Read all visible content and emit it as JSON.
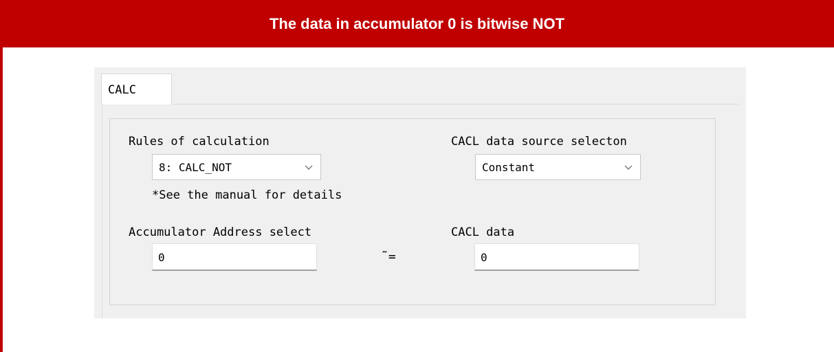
{
  "banner": {
    "title": "The data in accumulator 0 is bitwise NOT"
  },
  "tab": {
    "label": "CALC"
  },
  "rules": {
    "label": "Rules of calculation",
    "value": "8: CALC_NOT",
    "note": "*See the manual for details"
  },
  "source": {
    "label": "CACL data source selecton",
    "value": "Constant"
  },
  "accumulator": {
    "label": "Accumulator Address select",
    "value": "0"
  },
  "operator": {
    "symbol": "˜="
  },
  "cacl_data": {
    "label": "CACL data",
    "value": "0"
  },
  "colors": {
    "banner": "#c00000",
    "panel": "#f0f0f0"
  }
}
